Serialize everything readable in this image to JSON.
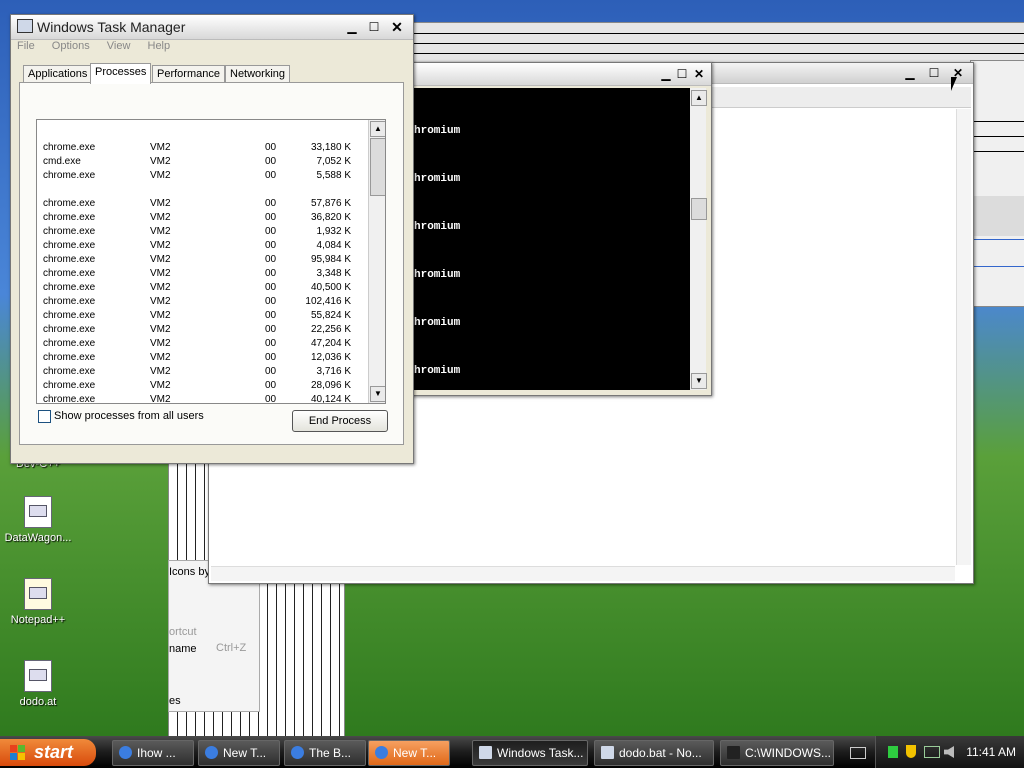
{
  "desktop_icons": [
    {
      "label": "Dev-C++"
    },
    {
      "label": "DataWagon..."
    },
    {
      "label": "Notepad++"
    },
    {
      "label": "dodo.at"
    }
  ],
  "background_fragments": {
    "icons_by": "Icons by",
    "shortcut": "ortcut",
    "name": "name",
    "ctrl_z": "Ctrl+Z",
    "es": "es"
  },
  "task_manager": {
    "title": "Windows Task Manager",
    "menu": [
      "File",
      "Options",
      "View",
      "Help"
    ],
    "tabs": [
      "Applications",
      "Processes",
      "Performance",
      "Networking"
    ],
    "active_tab": "Processes",
    "processes": [
      {
        "name": "chrome.exe",
        "user": "VM2",
        "cpu": "00",
        "mem": "33,180 K"
      },
      {
        "name": "cmd.exe",
        "user": "VM2",
        "cpu": "00",
        "mem": "7,052 K"
      },
      {
        "name": "chrome.exe",
        "user": "VM2",
        "cpu": "00",
        "mem": "5,588 K"
      },
      {
        "name": "chrome.exe",
        "user": "VM2",
        "cpu": "00",
        "mem": "57,876 K"
      },
      {
        "name": "chrome.exe",
        "user": "VM2",
        "cpu": "00",
        "mem": "36,820 K"
      },
      {
        "name": "chrome.exe",
        "user": "VM2",
        "cpu": "00",
        "mem": "1,932 K"
      },
      {
        "name": "chrome.exe",
        "user": "VM2",
        "cpu": "00",
        "mem": "4,084 K"
      },
      {
        "name": "chrome.exe",
        "user": "VM2",
        "cpu": "00",
        "mem": "95,984 K"
      },
      {
        "name": "chrome.exe",
        "user": "VM2",
        "cpu": "00",
        "mem": "3,348 K"
      },
      {
        "name": "chrome.exe",
        "user": "VM2",
        "cpu": "00",
        "mem": "40,500 K"
      },
      {
        "name": "chrome.exe",
        "user": "VM2",
        "cpu": "00",
        "mem": "102,416 K"
      },
      {
        "name": "chrome.exe",
        "user": "VM2",
        "cpu": "00",
        "mem": "55,824 K"
      },
      {
        "name": "chrome.exe",
        "user": "VM2",
        "cpu": "00",
        "mem": "22,256 K"
      },
      {
        "name": "chrome.exe",
        "user": "VM2",
        "cpu": "00",
        "mem": "47,204 K"
      },
      {
        "name": "chrome.exe",
        "user": "VM2",
        "cpu": "00",
        "mem": "12,036 K"
      },
      {
        "name": "chrome.exe",
        "user": "VM2",
        "cpu": "00",
        "mem": "3,716 K"
      },
      {
        "name": "chrome.exe",
        "user": "VM2",
        "cpu": "00",
        "mem": "28,096 K"
      },
      {
        "name": "chrome.exe",
        "user": "VM2",
        "cpu": "00",
        "mem": "40,124 K"
      }
    ],
    "show_all_label": "Show processes from all users",
    "show_all_checked": false,
    "end_process_label": "End Process"
  },
  "cmd_window": {
    "lines": [
      "hromium",
      "hromium",
      "hromium",
      "hromium",
      "hromium",
      "hromium"
    ]
  },
  "taskbar": {
    "start_label": "start",
    "buttons": [
      {
        "label": "Ihow ...",
        "icon": "chrome-icon",
        "state": "normal"
      },
      {
        "label": "New T...",
        "icon": "chrome-icon",
        "state": "normal"
      },
      {
        "label": "The B...",
        "icon": "chrome-icon",
        "state": "normal"
      },
      {
        "label": "New T...",
        "icon": "chrome-icon",
        "state": "highlight"
      },
      {
        "label": "Windows Task...",
        "icon": "taskmgr-icon",
        "state": "active"
      },
      {
        "label": "dodo.bat - No...",
        "icon": "notepad-icon",
        "state": "normal"
      },
      {
        "label": "C:\\WINDOWS...",
        "icon": "cmd-icon",
        "state": "normal"
      }
    ],
    "clock": "11:41 AM"
  },
  "colors": {
    "chrome_icon": "#3b7de0",
    "tray_green": "#2ecc40",
    "tray_shield": "#f2c200"
  }
}
